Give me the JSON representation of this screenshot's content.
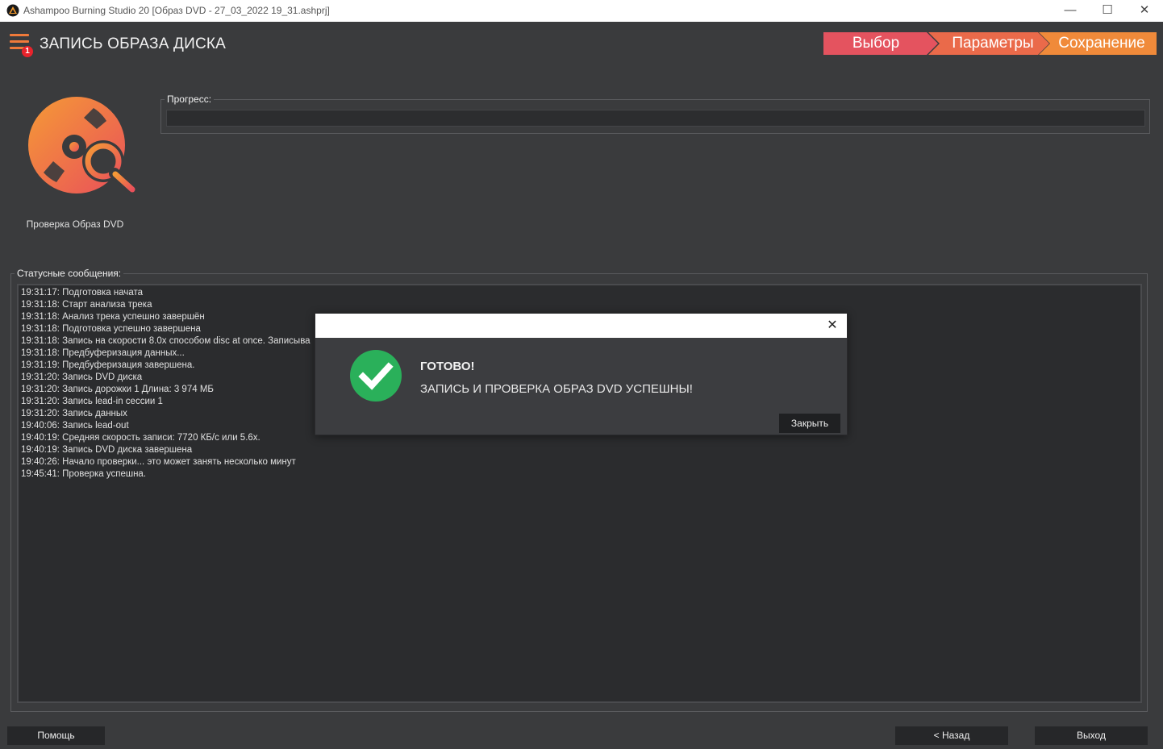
{
  "window": {
    "title": "Ashampoo Burning Studio 20 [Образ DVD - 27_03_2022 19_31.ashprj]",
    "minimize_glyph": "—",
    "maximize_glyph": "☐",
    "close_glyph": "✕"
  },
  "header": {
    "menu_badge": "1",
    "title": "ЗАПИСЬ ОБРАЗА ДИСКА",
    "steps": [
      {
        "label": "Выбор"
      },
      {
        "label": "Параметры"
      },
      {
        "label": "Сохранение"
      }
    ]
  },
  "task": {
    "icon": "disc-magnifier-icon",
    "caption": "Проверка Образ DVD"
  },
  "progress": {
    "label": "Прогресс:",
    "fraction": 0
  },
  "status": {
    "label": "Статусные сообщения:",
    "lines": [
      "19:31:17: Подготовка начата",
      "19:31:18: Старт анализа трека",
      "19:31:18: Анализ трека успешно завершён",
      "19:31:18: Подготовка успешно завершена",
      "19:31:18: Запись на скорости 8.0x способом disc at once. Записыва",
      "19:31:18: Предбуферизация данных...",
      "19:31:19: Предбуферизация завершена.",
      "19:31:20: Запись DVD диска",
      "19:31:20: Запись дорожки 1 Длина: 3 974 МБ",
      "19:31:20: Запись lead-in сессии 1",
      "19:31:20: Запись данных",
      "19:40:06: Запись lead-out",
      "19:40:19: Средняя скорость записи: 7720 КБ/с или 5.6x.",
      "19:40:19: Запись DVD диска завершена",
      "19:40:26: Начало проверки... это может занять несколько минут",
      "19:45:41: Проверка успешна."
    ]
  },
  "dialog": {
    "close_glyph": "✕",
    "icon": "check-circle-icon",
    "title": "ГОТОВО!",
    "message": "ЗАПИСЬ И ПРОВЕРКА ОБРАЗ DVD УСПЕШНЫ!",
    "close_button": "Закрыть"
  },
  "footer": {
    "help": "Помощь",
    "back": "< Назад",
    "exit": "Выход"
  },
  "colors": {
    "accent_orange": "#f08a3a",
    "step_red": "#e4535f",
    "success_green": "#2ab05a"
  }
}
